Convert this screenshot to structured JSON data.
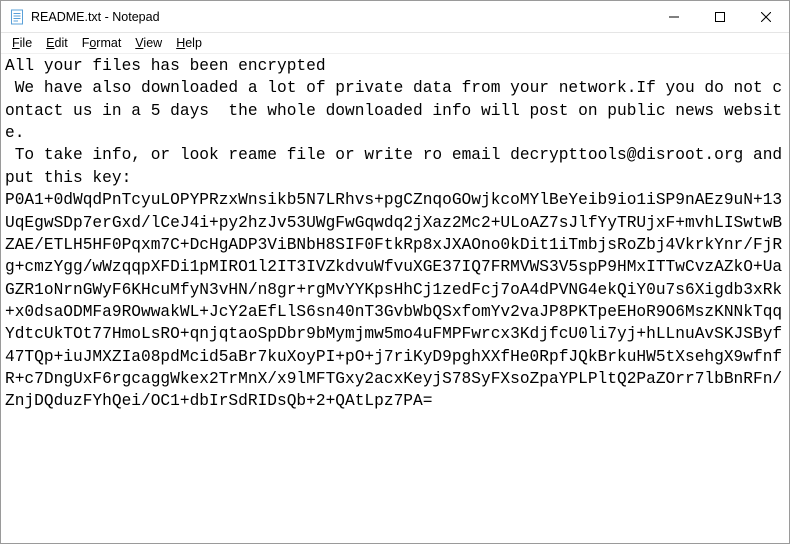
{
  "window": {
    "title": "README.txt - Notepad",
    "icon": "notepad-icon"
  },
  "menu": {
    "file": "File",
    "edit": "Edit",
    "format": "Format",
    "view": "View",
    "help": "Help"
  },
  "document": {
    "text": "All your files has been encrypted\n We have also downloaded a lot of private data from your network.If you do not contact us in a 5 days  the whole downloaded info will post on public news website.\n To take info, or look reame file or write ro email decrypttools@disroot.org and put this key:\nP0A1+0dWqdPnTcyuLOPYPRzxWnsikb5N7LRhvs+pgCZnqoGOwjkcoMYlBeYeib9io1iSP9nAEz9uN+13UqEgwSDp7erGxd/lCeJ4i+py2hzJv53UWgFwGqwdq2jXaz2Mc2+ULoAZ7sJlfYyTRUjxF+mvhLISwtwBZAE/ETLH5HF0Pqxm7C+DcHgADP3ViBNbH8SIF0FtkRp8xJXAOno0kDit1iTmbjsRoZbj4VkrkYnr/FjRg+cmzYgg/wWzqqpXFDi1pMIRO1l2IT3IVZkdvuWfvuXGE37IQ7FRMVWS3V5spP9HMxITTwCvzAZkO+UaGZR1oNrnGWyF6KHcuMfyN3vHN/n8gr+rgMvYYKpsHhCj1zedFcj7oA4dPVNG4ekQiY0u7s6Xigdb3xRk+x0dsaODMFa9ROwwakWL+JcY2aEfLlS6sn40nT3GvbWbQSxfomYv2vaJP8PKTpeEHoR9O6MszKNNkTqqYdtcUkTOt77HmoLsRO+qnjqtaoSpDbr9bMymjmw5mo4uFMPFwrcx3KdjfcU0li7yj+hLLnuAvSKJSByf47TQp+iuJMXZIa08pdMcid5aBr7kuXoyPI+pO+j7riKyD9pghXXfHe0RpfJQkBrkuHW5tXsehgX9wfnfR+c7DngUxF6rgcaggWkex2TrMnX/x9lMFTGxy2acxKeyjS78SyFXsoZpaYPLPltQ2PaZOrr7lbBnRFn/ZnjDQduzFYhQei/OC1+dbIrSdRIDsQb+2+QAtLpz7PA="
  },
  "watermark": ""
}
